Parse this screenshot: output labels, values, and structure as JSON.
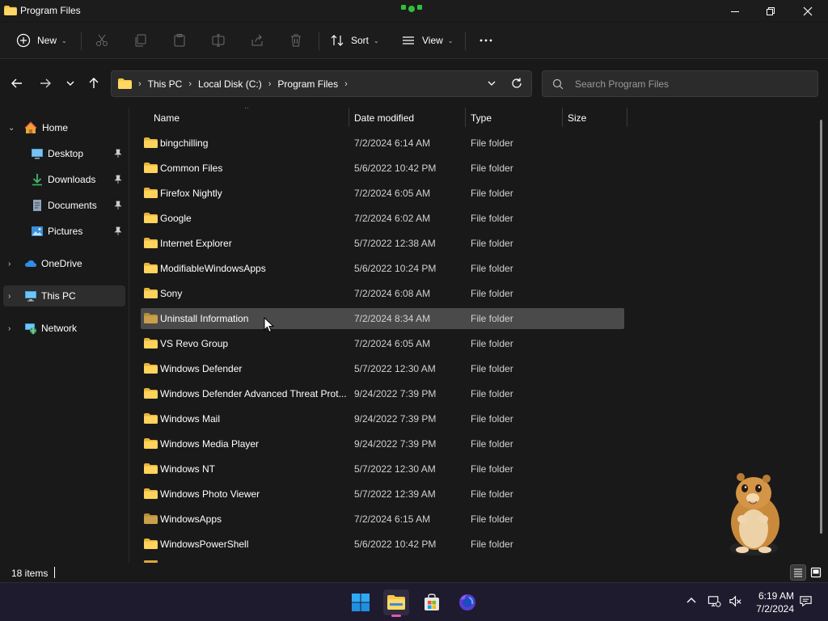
{
  "window": {
    "title": "Program Files",
    "buttons": {
      "minimize": "minimize-icon",
      "restore": "restore-icon",
      "close": "close-icon"
    }
  },
  "toolbar": {
    "new_label": "New",
    "sort_label": "Sort",
    "view_label": "View",
    "icons": [
      "cut-icon",
      "copy-icon",
      "paste-icon",
      "rename-icon",
      "share-icon",
      "delete-icon",
      "more-icon"
    ]
  },
  "address": {
    "breadcrumbs": [
      "This PC",
      "Local Disk (C:)",
      "Program Files"
    ]
  },
  "search": {
    "placeholder": "Search Program Files"
  },
  "sidebar": {
    "items": [
      {
        "label": "Home"
      },
      {
        "label": "Desktop"
      },
      {
        "label": "Downloads"
      },
      {
        "label": "Documents"
      },
      {
        "label": "Pictures"
      },
      {
        "label": "OneDrive"
      },
      {
        "label": "This PC"
      },
      {
        "label": "Network"
      }
    ]
  },
  "columns": {
    "name": "Name",
    "date": "Date modified",
    "type": "Type",
    "size": "Size"
  },
  "files": [
    {
      "name": "bingchilling",
      "date": "7/2/2024 6:14 AM",
      "type": "File folder"
    },
    {
      "name": "Common Files",
      "date": "5/6/2022 10:42 PM",
      "type": "File folder"
    },
    {
      "name": "Firefox Nightly",
      "date": "7/2/2024 6:05 AM",
      "type": "File folder"
    },
    {
      "name": "Google",
      "date": "7/2/2024 6:02 AM",
      "type": "File folder"
    },
    {
      "name": "Internet Explorer",
      "date": "5/7/2022 12:38 AM",
      "type": "File folder"
    },
    {
      "name": "ModifiableWindowsApps",
      "date": "5/6/2022 10:24 PM",
      "type": "File folder"
    },
    {
      "name": "Sony",
      "date": "7/2/2024 6:08 AM",
      "type": "File folder"
    },
    {
      "name": "Uninstall Information",
      "date": "7/2/2024 8:34 AM",
      "type": "File folder"
    },
    {
      "name": "VS Revo Group",
      "date": "7/2/2024 6:05 AM",
      "type": "File folder"
    },
    {
      "name": "Windows Defender",
      "date": "5/7/2022 12:30 AM",
      "type": "File folder"
    },
    {
      "name": "Windows Defender Advanced Threat Prot...",
      "date": "9/24/2022 7:39 PM",
      "type": "File folder"
    },
    {
      "name": "Windows Mail",
      "date": "9/24/2022 7:39 PM",
      "type": "File folder"
    },
    {
      "name": "Windows Media Player",
      "date": "9/24/2022 7:39 PM",
      "type": "File folder"
    },
    {
      "name": "Windows NT",
      "date": "5/7/2022 12:30 AM",
      "type": "File folder"
    },
    {
      "name": "Windows Photo Viewer",
      "date": "5/7/2022 12:39 AM",
      "type": "File folder"
    },
    {
      "name": "WindowsApps",
      "date": "7/2/2024 6:15 AM",
      "type": "File folder"
    },
    {
      "name": "WindowsPowerShell",
      "date": "5/6/2022 10:42 PM",
      "type": "File folder"
    }
  ],
  "status": {
    "count": "18 items"
  },
  "taskbar": {
    "apps": [
      "windows-start-icon",
      "file-explorer-icon",
      "microsoft-store-icon",
      "firefox-nightly-icon"
    ],
    "tray_icons": [
      "chevron-up-icon",
      "network-icon",
      "volume-muted-icon",
      "notification-icon"
    ],
    "time": "6:19 AM",
    "date": "7/2/2024"
  },
  "colors": {
    "background": "#191919",
    "folder": "#f7c948",
    "hover_row": "#4a4a4a",
    "taskbar": "#1f1b2e",
    "accent_indicator": "#e05aa8"
  }
}
